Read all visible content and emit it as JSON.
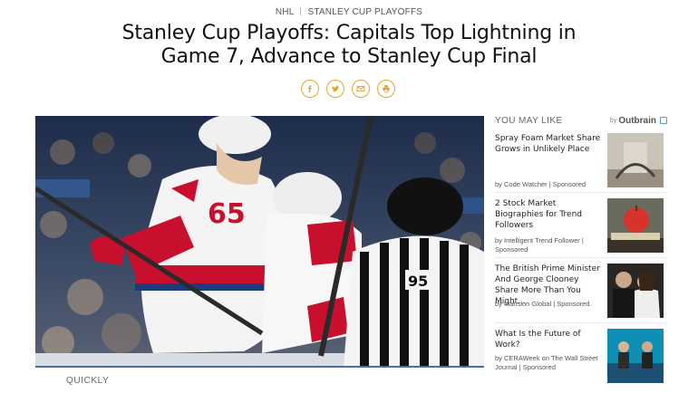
{
  "breadcrumb": {
    "section": "NHL",
    "subsection": "STANLEY CUP PLAYOFFS"
  },
  "article": {
    "title": "Stanley Cup Playoffs: Capitals Top Lightning in Game 7, Advance to Stanley Cup Final",
    "share_icons": [
      "facebook-icon",
      "twitter-icon",
      "email-icon",
      "print-icon"
    ],
    "hero_numbers": {
      "player": "65",
      "referee": "95"
    },
    "caption": "QUICKLY"
  },
  "colors": {
    "accent": "#e0a82a",
    "capitals_red": "#c8102e",
    "lightning_blue": "#1b3b7a"
  },
  "rail": {
    "heading": "YOU MAY LIKE",
    "by_label": "by",
    "brand": "Outbrain",
    "items": [
      {
        "headline": "Spray Foam Market Share Grows in Unlikely Place",
        "source": "by Code Watcher | Sponsored"
      },
      {
        "headline": "2 Stock Market Biographies for Trend Followers",
        "source": "by Intelligent Trend Follower | Sponsored"
      },
      {
        "headline": "The British Prime Minister And George Clooney Share More Than You Might...",
        "source": "by Mansion Global | Sponsored"
      },
      {
        "headline": "What Is the Future of Work?",
        "source": "by CERAWeek on The Wall Street Journal | Sponsored"
      }
    ]
  }
}
